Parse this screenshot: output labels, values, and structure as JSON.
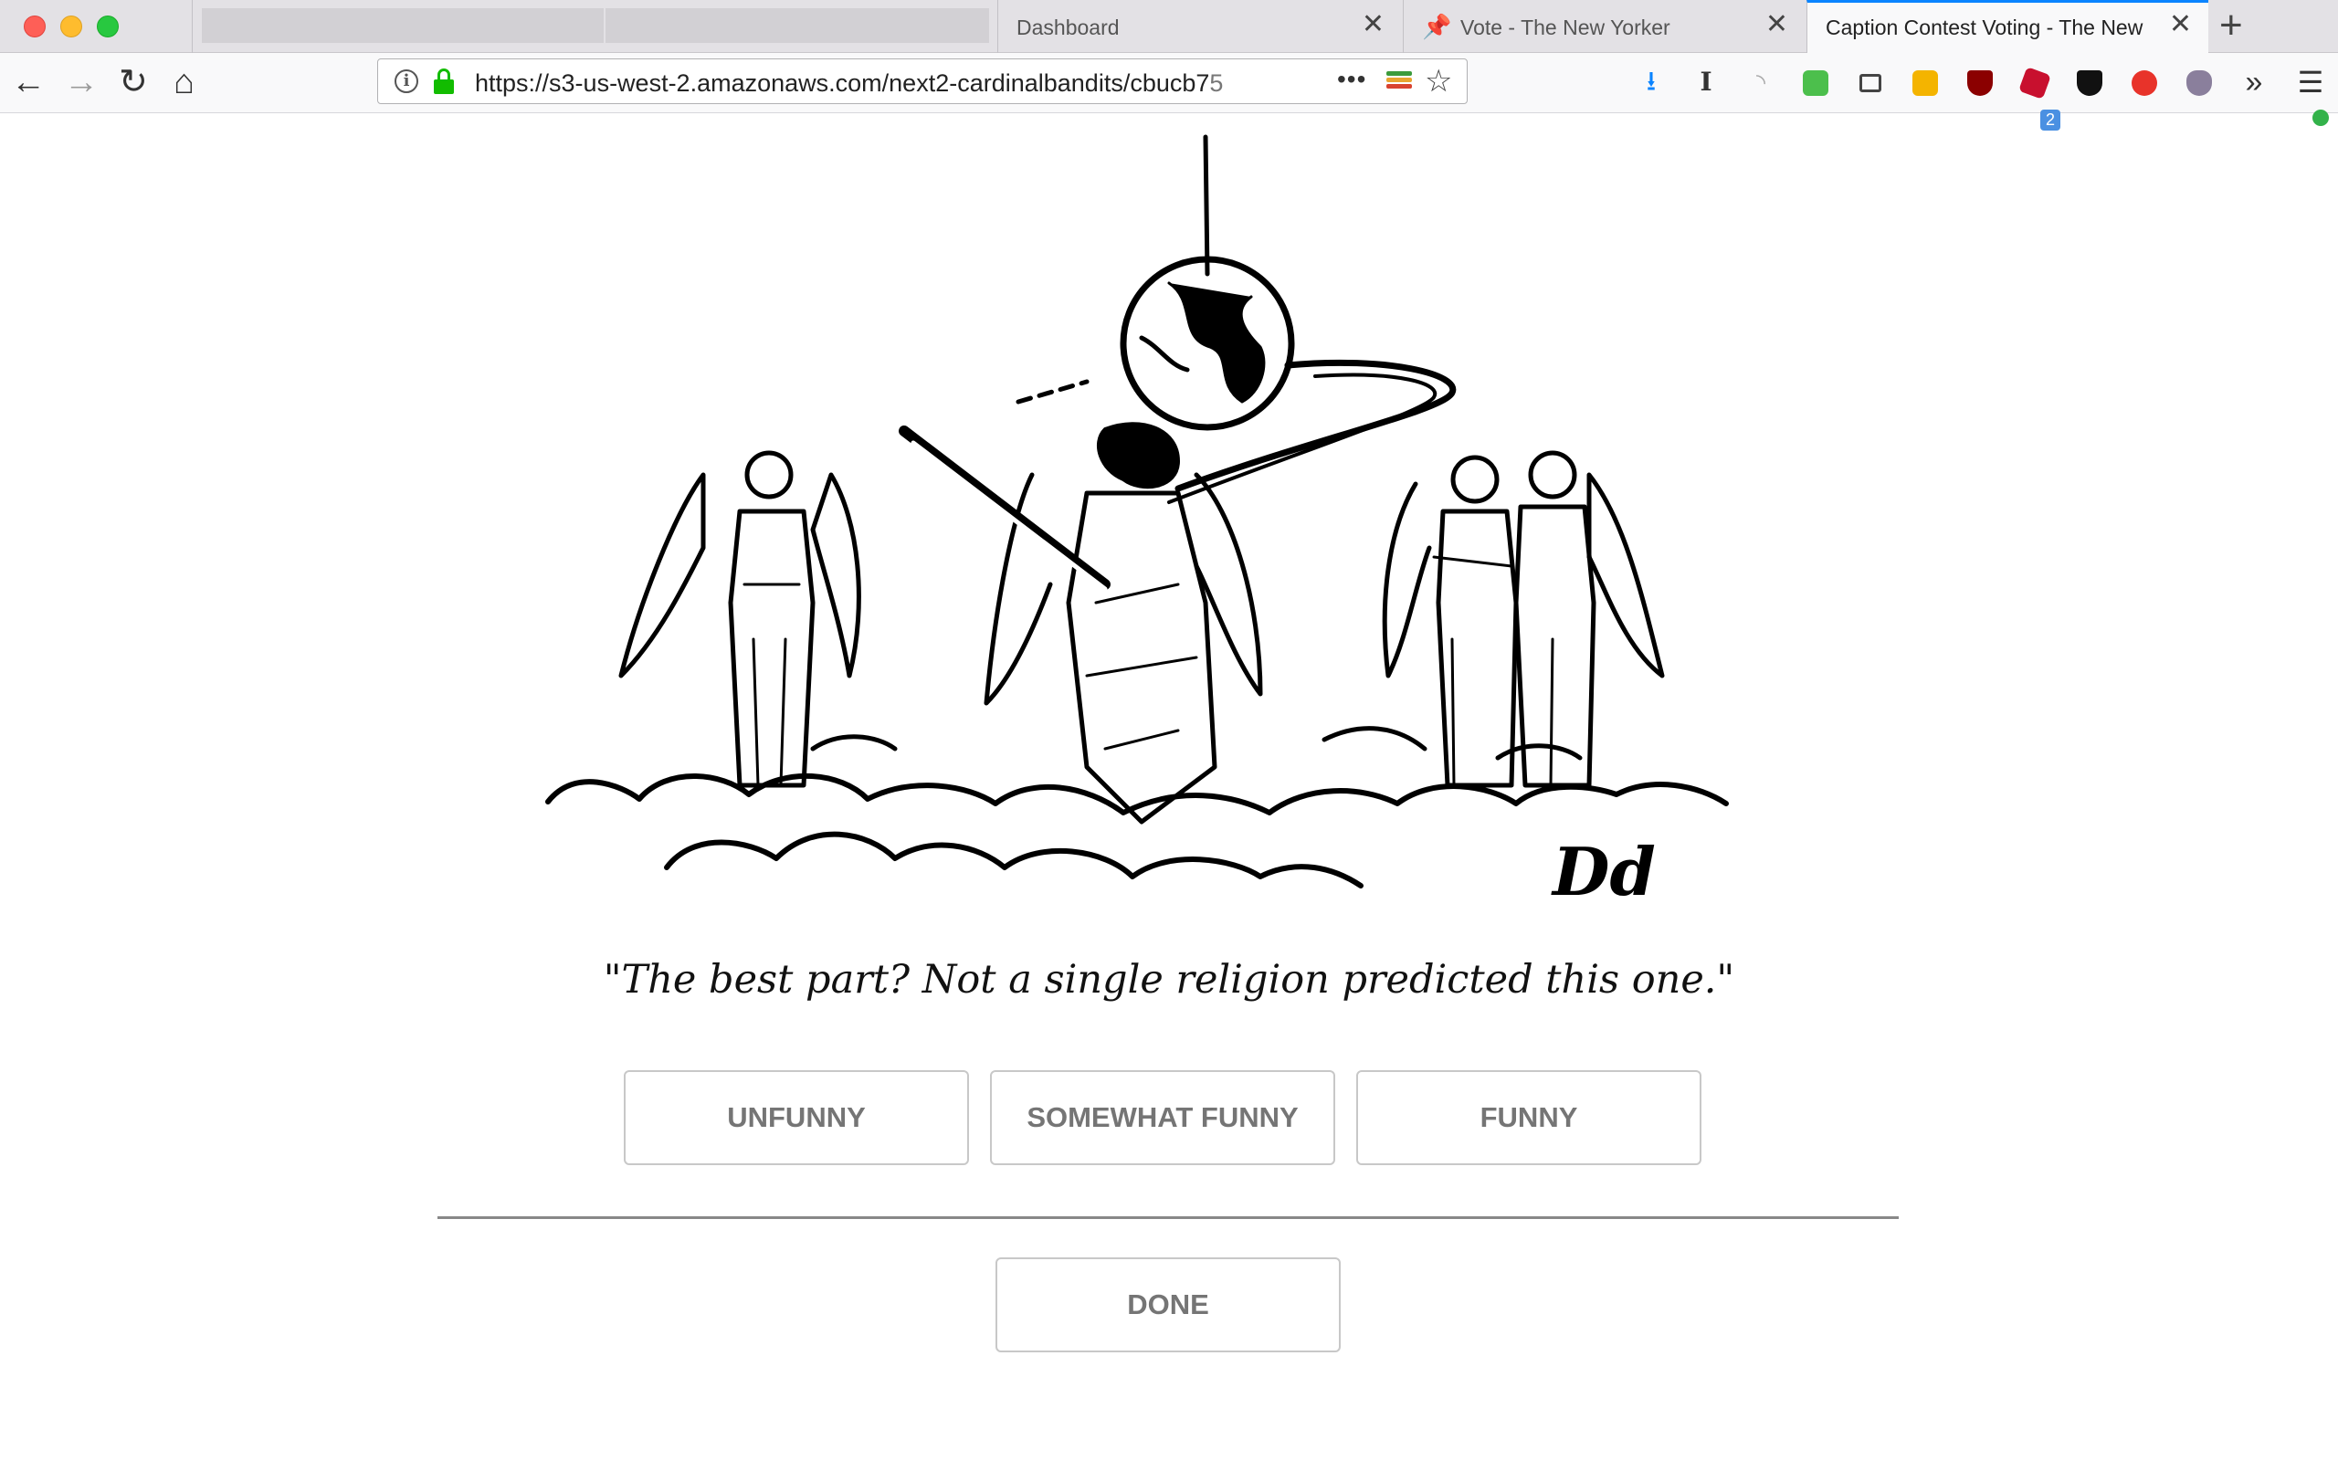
{
  "browser": {
    "tabs": [
      {
        "title": ""
      },
      {
        "title": "Dashboard"
      },
      {
        "title": "Vote - The New Yorker"
      },
      {
        "title": "Caption Contest Voting - The New"
      }
    ],
    "url": {
      "main": "https://s3-us-west-2.amazonaws.com/next2-cardinalbandits/cbucb7",
      "faded": "5"
    },
    "extension_badge": "2"
  },
  "page": {
    "caption": "\"The best part? Not a single religion predicted this one.\"",
    "signature": "Dd",
    "buttons": {
      "unfunny": "UNFUNNY",
      "somewhat": "SOMEWHAT FUNNY",
      "funny": "FUNNY",
      "done": "DONE"
    }
  },
  "icons": {
    "tab_close": "close-icon",
    "new_tab": "plus-icon",
    "nav": [
      "back-arrow-icon",
      "forward-arrow-icon",
      "reload-icon",
      "home-icon"
    ],
    "url": [
      "info-icon",
      "lock-icon",
      "page-actions-icon",
      "reader-stripes-icon",
      "bookmark-star-icon"
    ],
    "toolbar": [
      "download-icon",
      "text-cursor-icon",
      "rss-icon",
      "green-extension-icon",
      "sidebar-icon",
      "lock-extension-icon",
      "ublock-icon",
      "dice-icon",
      "w-shield-icon",
      "red-circle-icon",
      "cat-icon",
      "overflow-chevrons-icon",
      "hamburger-menu-icon"
    ]
  }
}
